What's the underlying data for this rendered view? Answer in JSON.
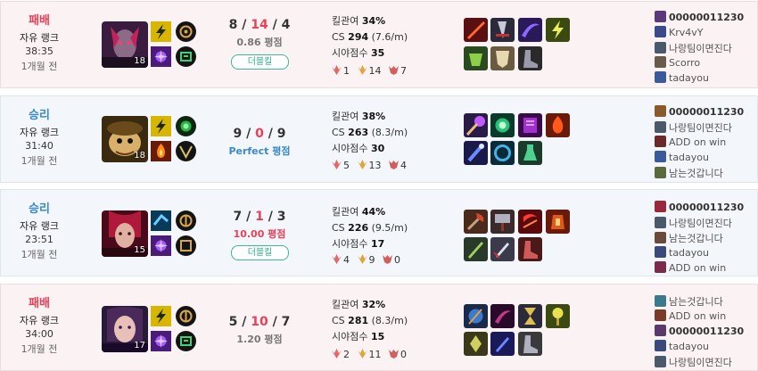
{
  "matches": [
    {
      "result": "패배",
      "mode": "자유 랭크",
      "duration": "38:35",
      "ago": "1개월 전",
      "level": "18",
      "k": "8",
      "d": "14",
      "a": "4",
      "ratio": "0.86 평점",
      "badge": "더블킬",
      "kp_label": "킬관여",
      "kp": "34%",
      "cs_label": "CS",
      "cs": "294",
      "cspm": "(7.6/m)",
      "vision_label": "시야점수",
      "vision": "35",
      "medal1": "1",
      "medal2": "14",
      "medal3": "7",
      "players": [
        "00000011230",
        "Krv4vY",
        "나랑팀이면진다",
        "Scorro",
        "tadayou"
      ]
    },
    {
      "result": "승리",
      "mode": "자유 랭크",
      "duration": "31:40",
      "ago": "1개월 전",
      "level": "18",
      "k": "9",
      "d": "0",
      "a": "9",
      "ratio_word": "Perfect",
      "ratio_suffix": "평점",
      "kp_label": "킬관여",
      "kp": "38%",
      "cs_label": "CS",
      "cs": "263",
      "cspm": "(8.3/m)",
      "vision_label": "시야점수",
      "vision": "30",
      "medal1": "5",
      "medal2": "13",
      "medal3": "4",
      "players": [
        "00000011230",
        "나랑팀이면진다",
        "ADD on win",
        "tadayou",
        "남는것갑니다"
      ]
    },
    {
      "result": "승리",
      "mode": "자유 랭크",
      "duration": "23:51",
      "ago": "1개월 전",
      "level": "15",
      "k": "7",
      "d": "1",
      "a": "3",
      "ratio": "10.00 평점",
      "badge": "더블킬",
      "kp_label": "킬관여",
      "kp": "44%",
      "cs_label": "CS",
      "cs": "226",
      "cspm": "(9.5/m)",
      "vision_label": "시야점수",
      "vision": "17",
      "medal1": "4",
      "medal2": "9",
      "medal3": "0",
      "players": [
        "00000011230",
        "나랑팀이면진다",
        "남는것갑니다",
        "tadayou",
        "ADD on win"
      ]
    },
    {
      "result": "패배",
      "mode": "자유 랭크",
      "duration": "34:00",
      "ago": "1개월 전",
      "level": "17",
      "k": "5",
      "d": "10",
      "a": "7",
      "ratio": "1.20 평점",
      "kp_label": "킬관여",
      "kp": "32%",
      "cs_label": "CS",
      "cs": "281",
      "cspm": "(8.3/m)",
      "vision_label": "시야점수",
      "vision": "15",
      "medal1": "2",
      "medal2": "11",
      "medal3": "0",
      "players": [
        "남는것갑니다",
        "ADD on win",
        "00000011230",
        "tadayou",
        "나랑팀이면진다"
      ]
    }
  ],
  "colors": {
    "loss": "#e84057",
    "win": "#3a89c9",
    "badge": "#2aa887"
  }
}
